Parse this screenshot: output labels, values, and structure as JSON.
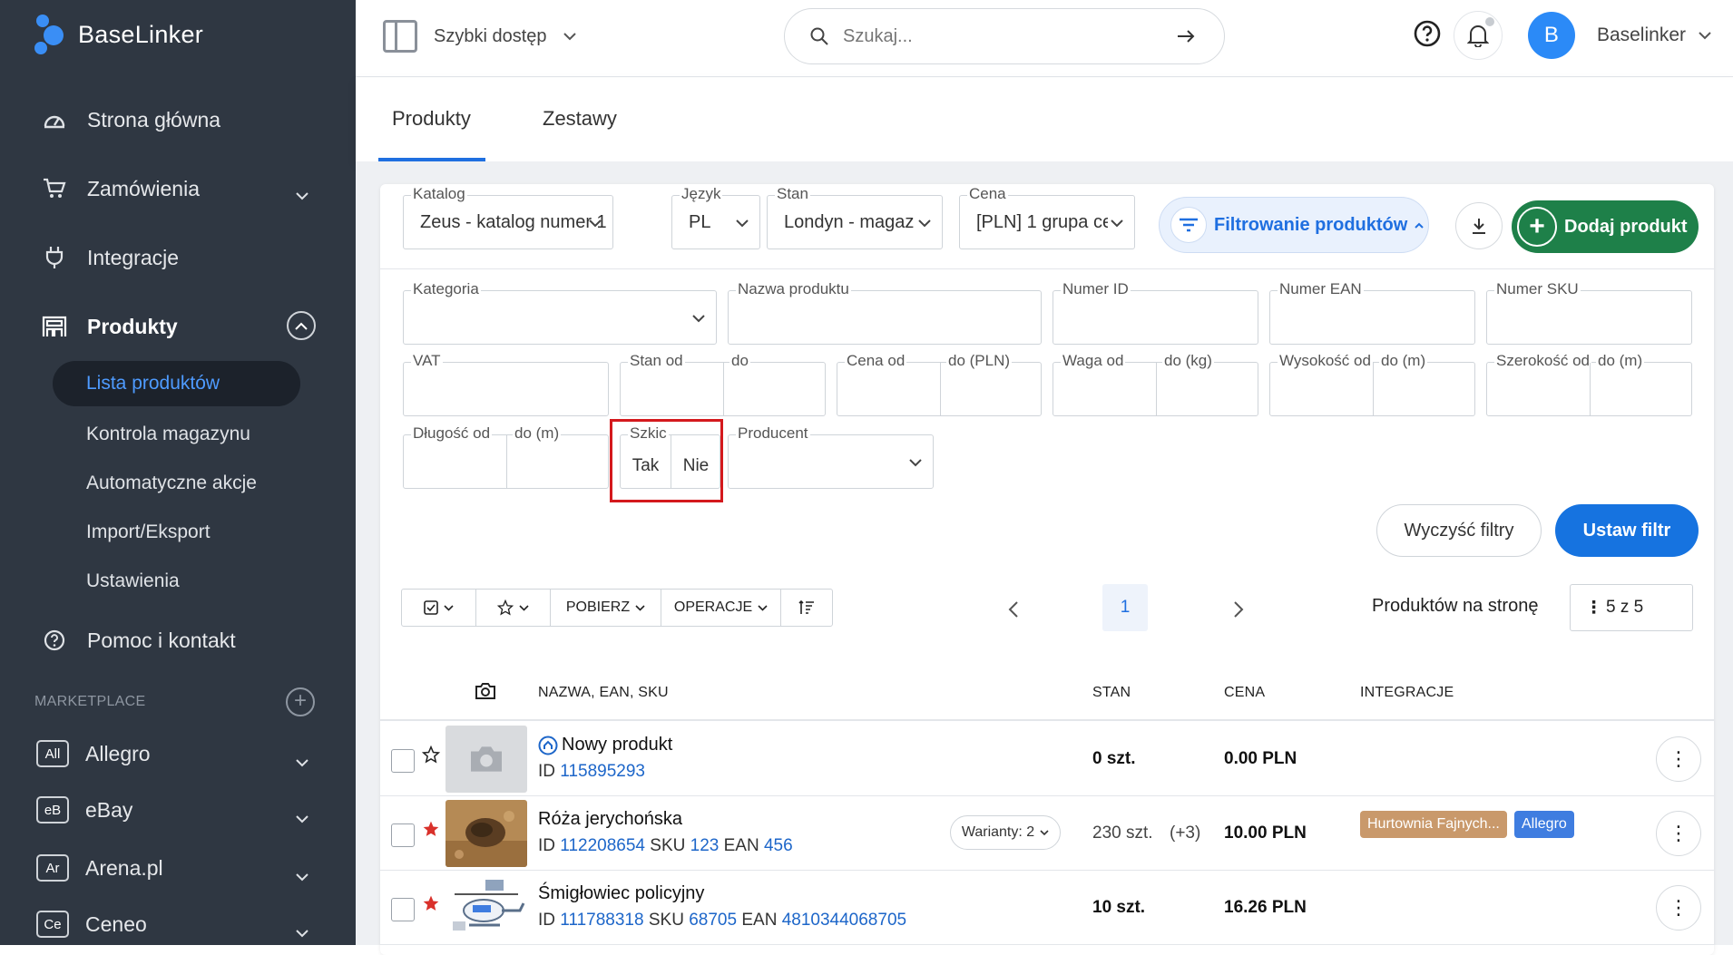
{
  "app": {
    "logo_text": "BaseLinker"
  },
  "sidebar": {
    "items": [
      {
        "label": "Strona główna",
        "icon": "dashboard-icon"
      },
      {
        "label": "Zamówienia",
        "icon": "cart-icon"
      },
      {
        "label": "Integracje",
        "icon": "plug-icon"
      },
      {
        "label": "Produkty",
        "icon": "warehouse-icon"
      }
    ],
    "sub_items": [
      "Lista produktów",
      "Kontrola magazynu",
      "Automatyczne akcje",
      "Import/Eksport",
      "Ustawienia"
    ],
    "help_label": "Pomoc i kontakt",
    "marketplace_label": "MARKETPLACE",
    "marketplaces": [
      {
        "badge": "All",
        "label": "Allegro"
      },
      {
        "badge": "eB",
        "label": "eBay"
      },
      {
        "badge": "Ar",
        "label": "Arena.pl"
      },
      {
        "badge": "Ce",
        "label": "Ceneo"
      }
    ]
  },
  "topbar": {
    "quick_access": "Szybki dostęp",
    "search_placeholder": "Szukaj...",
    "avatar_letter": "B",
    "user_name": "Baselinker"
  },
  "tabs": [
    "Produkty",
    "Zestawy"
  ],
  "selectors": {
    "katalog": {
      "label": "Katalog",
      "value": "Zeus - katalog numer 1"
    },
    "jezyk": {
      "label": "Język",
      "value": "PL"
    },
    "stan": {
      "label": "Stan",
      "value": "Londyn - magaz"
    },
    "cena": {
      "label": "Cena",
      "value": "[PLN] 1 grupa ce"
    }
  },
  "buttons": {
    "filter": "Filtrowanie produktów",
    "add": "Dodaj produkt",
    "clear": "Wyczyść filtry",
    "set": "Ustaw filtr"
  },
  "filters": {
    "kategoria": "Kategoria",
    "nazwa": "Nazwa produktu",
    "numer_id": "Numer ID",
    "numer_ean": "Numer EAN",
    "numer_sku": "Numer SKU",
    "vat": "VAT",
    "stan_od": "Stan od",
    "stan_do": "do",
    "cena_od": "Cena od",
    "cena_do": "do (PLN)",
    "waga_od": "Waga od",
    "waga_do": "do (kg)",
    "wys_od": "Wysokość od",
    "wys_do": "do (m)",
    "szer_od": "Szerokość od",
    "szer_do": "do (m)",
    "dl_od": "Długość od",
    "dl_do": "do (m)",
    "szkic": "Szkic",
    "szkic_tak": "Tak",
    "szkic_nie": "Nie",
    "producent": "Producent"
  },
  "toolbar": {
    "pobierz": "POBIERZ",
    "operacje": "OPERACJE"
  },
  "pagination": {
    "current": "1",
    "per_page_label": "Produktów na stronę",
    "per_page_value": "5 z 5"
  },
  "table": {
    "headers": {
      "name": "NAZWA, EAN, SKU",
      "stan": "STAN",
      "cena": "CENA",
      "integracje": "INTEGRACJE"
    },
    "rows": [
      {
        "name": "Nowy produkt",
        "id_label": "ID",
        "id": "115895293",
        "stan": "0 szt.",
        "cena": "0.00 PLN",
        "starred": false
      },
      {
        "name": "Róża jerychońska",
        "id_label": "ID",
        "id": "112208654",
        "sku_label": "SKU",
        "sku": "123",
        "ean_label": "EAN",
        "ean": "456",
        "variants": "Warianty: 2",
        "stan": "230 szt.",
        "stan_extra": "(+3)",
        "cena": "10.00 PLN",
        "tags": [
          "Hurtownia Fajnych...",
          "Allegro"
        ],
        "starred": true
      },
      {
        "name": "Śmigłowiec policyjny",
        "id_label": "ID",
        "id": "111788318",
        "sku_label": "SKU",
        "sku": "68705",
        "ean_label": "EAN",
        "ean": "4810344068705",
        "stan": "10 szt.",
        "cena": "16.26 PLN",
        "starred": true
      }
    ]
  },
  "colors": {
    "sidebar": "#2f3742",
    "accent": "#1673e0",
    "add_green": "#1e8049",
    "highlight": "#d4191d",
    "star": "#d9312b",
    "tag_wholesale": "#c9996b",
    "tag_allegro": "#3f7de0"
  }
}
